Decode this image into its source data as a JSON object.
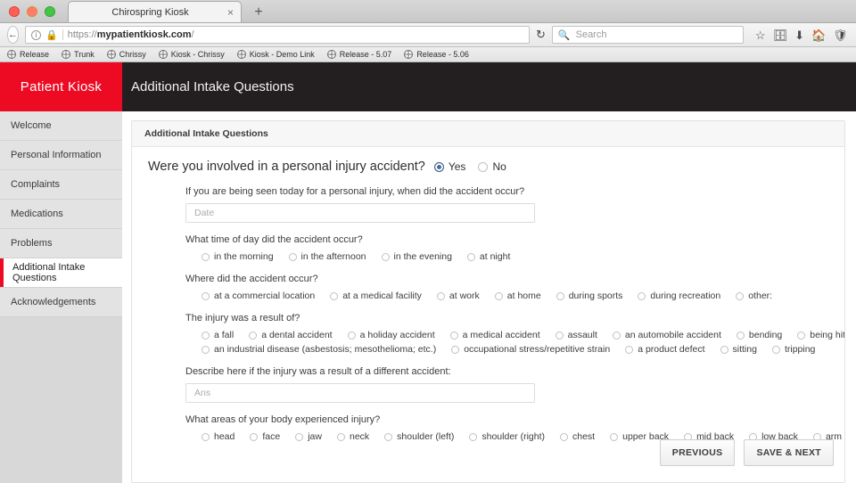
{
  "browser": {
    "window_controls": [
      "close",
      "minimize",
      "maximize"
    ],
    "tab": {
      "title": "Chirospring Kiosk",
      "close_glyph": "×"
    },
    "new_tab_glyph": "+",
    "nav": {
      "back_glyph": "←",
      "info_glyph": "i",
      "lock_glyph": "🔒",
      "reload_glyph": "↻"
    },
    "url": {
      "scheme": "https://",
      "host": "mypatientkiosk.com",
      "path": "/"
    },
    "search": {
      "placeholder": "Search",
      "icon": "search-icon"
    },
    "toolbar_icons": [
      "star-icon",
      "library-icon",
      "download-icon",
      "home-icon",
      "pocket-icon",
      "hamburger-menu-icon"
    ],
    "bookmarks": [
      "Release",
      "Trunk",
      "Chrissy",
      "Kiosk - Chrissy",
      "Kiosk - Demo Link",
      "Release - 5.07",
      "Release - 5.06"
    ]
  },
  "app": {
    "brand": "Patient Kiosk",
    "brand_color": "#ed0b24",
    "header_color": "#231f20",
    "page_title": "Additional Intake Questions",
    "sidebar": {
      "items": [
        {
          "label": "Welcome",
          "active": false
        },
        {
          "label": "Personal Information",
          "active": false
        },
        {
          "label": "Complaints",
          "active": false
        },
        {
          "label": "Medications",
          "active": false
        },
        {
          "label": "Problems",
          "active": false
        },
        {
          "label": "Additional Intake Questions",
          "active": true
        },
        {
          "label": "Acknowledgements",
          "active": false
        }
      ]
    },
    "card": {
      "header": "Additional Intake Questions",
      "main_question": {
        "text": "Were you involved in a personal injury accident?",
        "options": [
          {
            "label": "Yes",
            "selected": true
          },
          {
            "label": "No",
            "selected": false
          }
        ]
      },
      "questions": [
        {
          "id": "accident-date",
          "label": "If you are being seen today for a personal injury, when did the accident occur?",
          "type": "text",
          "value": "",
          "placeholder": "Date"
        },
        {
          "id": "time-of-day",
          "label": "What time of day did the accident occur?",
          "type": "radio",
          "options": [
            "in the morning",
            "in the afternoon",
            "in the evening",
            "at night"
          ]
        },
        {
          "id": "accident-location",
          "label": "Where did the accident occur?",
          "type": "radio",
          "options": [
            "at a commercial location",
            "at a medical facility",
            "at work",
            "at home",
            "during sports",
            "during recreation",
            "other:"
          ]
        },
        {
          "id": "injury-cause",
          "label": "The injury was a result of?",
          "type": "radio",
          "rows": [
            [
              "a fall",
              "a dental accident",
              "a holiday accident",
              "a medical accident",
              "assault",
              "an automobile accident",
              "bending",
              "being hit"
            ],
            [
              "an industrial disease (asbestosis; mesothelioma; etc.)",
              "occupational stress/repetitive strain",
              "a product defect",
              "sitting",
              "tripping"
            ]
          ]
        },
        {
          "id": "other-accident-describe",
          "label": "Describe here if the injury was a result of a different accident:",
          "type": "text",
          "value": "",
          "placeholder": "Ans"
        },
        {
          "id": "body-areas",
          "label": "What areas of your body experienced injury?",
          "type": "radio",
          "options": [
            "head",
            "face",
            "jaw",
            "neck",
            "shoulder (left)",
            "shoulder (right)",
            "chest",
            "upper back",
            "mid back",
            "low back",
            "arm (left)"
          ]
        }
      ],
      "buttons": {
        "previous": "PREVIOUS",
        "save_next": "SAVE & NEXT"
      }
    }
  }
}
